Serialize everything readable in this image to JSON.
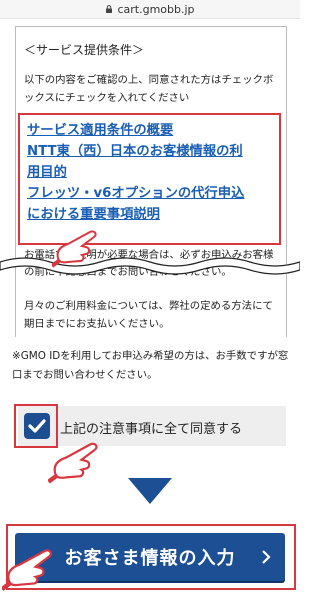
{
  "browser": {
    "url": "cart.gmobb.jp"
  },
  "conditions": {
    "heading": "＜サービス提供条件＞",
    "intro": "以下の内容をご確認の上、同意された方はチェックボックスにチェックを入れてください",
    "links": [
      "サービス適用条件の概要",
      "NTT東（西）日本のお客様情報の利",
      "用目的",
      "フレッツ・v6オプションの代行申込",
      "における重要事項説明"
    ],
    "note1": "お電話でご説明が必要な場合は、必ずお申込みお客様の前に下記窓口までお問い合わせください。",
    "note2": "月々のご利用料金については、弊社の定める方法にて期日までにお支払いください。"
  },
  "gmo_note": "※GMO IDを利用してお申込み希望の方は、お手数ですが窓口までお問い合わせください。",
  "agreement": {
    "label": "上記の注意事項に全て同意する",
    "checked": true
  },
  "submit": {
    "label": "お客さま情報の入力"
  },
  "colors": {
    "accent": "#1c4f94",
    "link": "#1a5fb4",
    "highlight": "#d7373f"
  }
}
